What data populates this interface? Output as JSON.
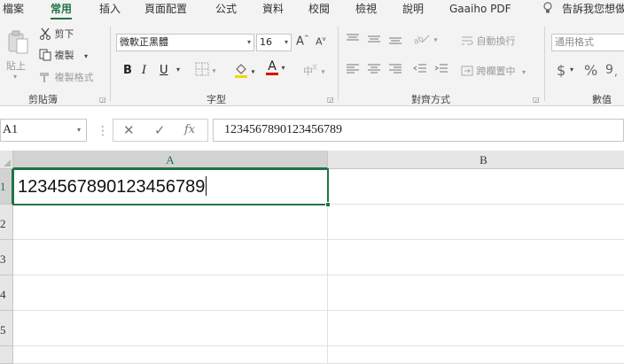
{
  "ribbon_tabs": [
    "檔案",
    "常用",
    "插入",
    "頁面配置",
    "公式",
    "資料",
    "校閱",
    "檢視",
    "說明",
    "Gaaiho PDF"
  ],
  "active_tab": "常用",
  "tell_me": "告訴我您想做",
  "clipboard": {
    "paste": "貼上",
    "cut": "剪下",
    "copy": "複製",
    "format_painter": "複製格式",
    "group": "剪貼簿"
  },
  "font": {
    "name": "微軟正黑體",
    "size": "16",
    "bold": "B",
    "italic": "I",
    "underline": "U",
    "grow": "A",
    "shrink": "A",
    "font_color_letter": "A",
    "font_color": "#e00000",
    "group": "字型"
  },
  "alignment": {
    "wrap_text": "自動換行",
    "merge_center": "跨欄置中",
    "group": "對齊方式"
  },
  "number": {
    "format": "通用格式",
    "currency": "$",
    "percent": "%",
    "group": "數值"
  },
  "formula_bar": {
    "name_box": "A1",
    "fx": "fx",
    "value": "1234567890123456789"
  },
  "grid": {
    "columns": [
      "A",
      "B"
    ],
    "rows": [
      "1",
      "2",
      "3",
      "4",
      "5"
    ],
    "active_cell_value": "1234567890123456789"
  },
  "colors": {
    "accent": "#217346",
    "ribbon_bg": "#f3f3f3",
    "header_bg": "#e6e6e6"
  }
}
